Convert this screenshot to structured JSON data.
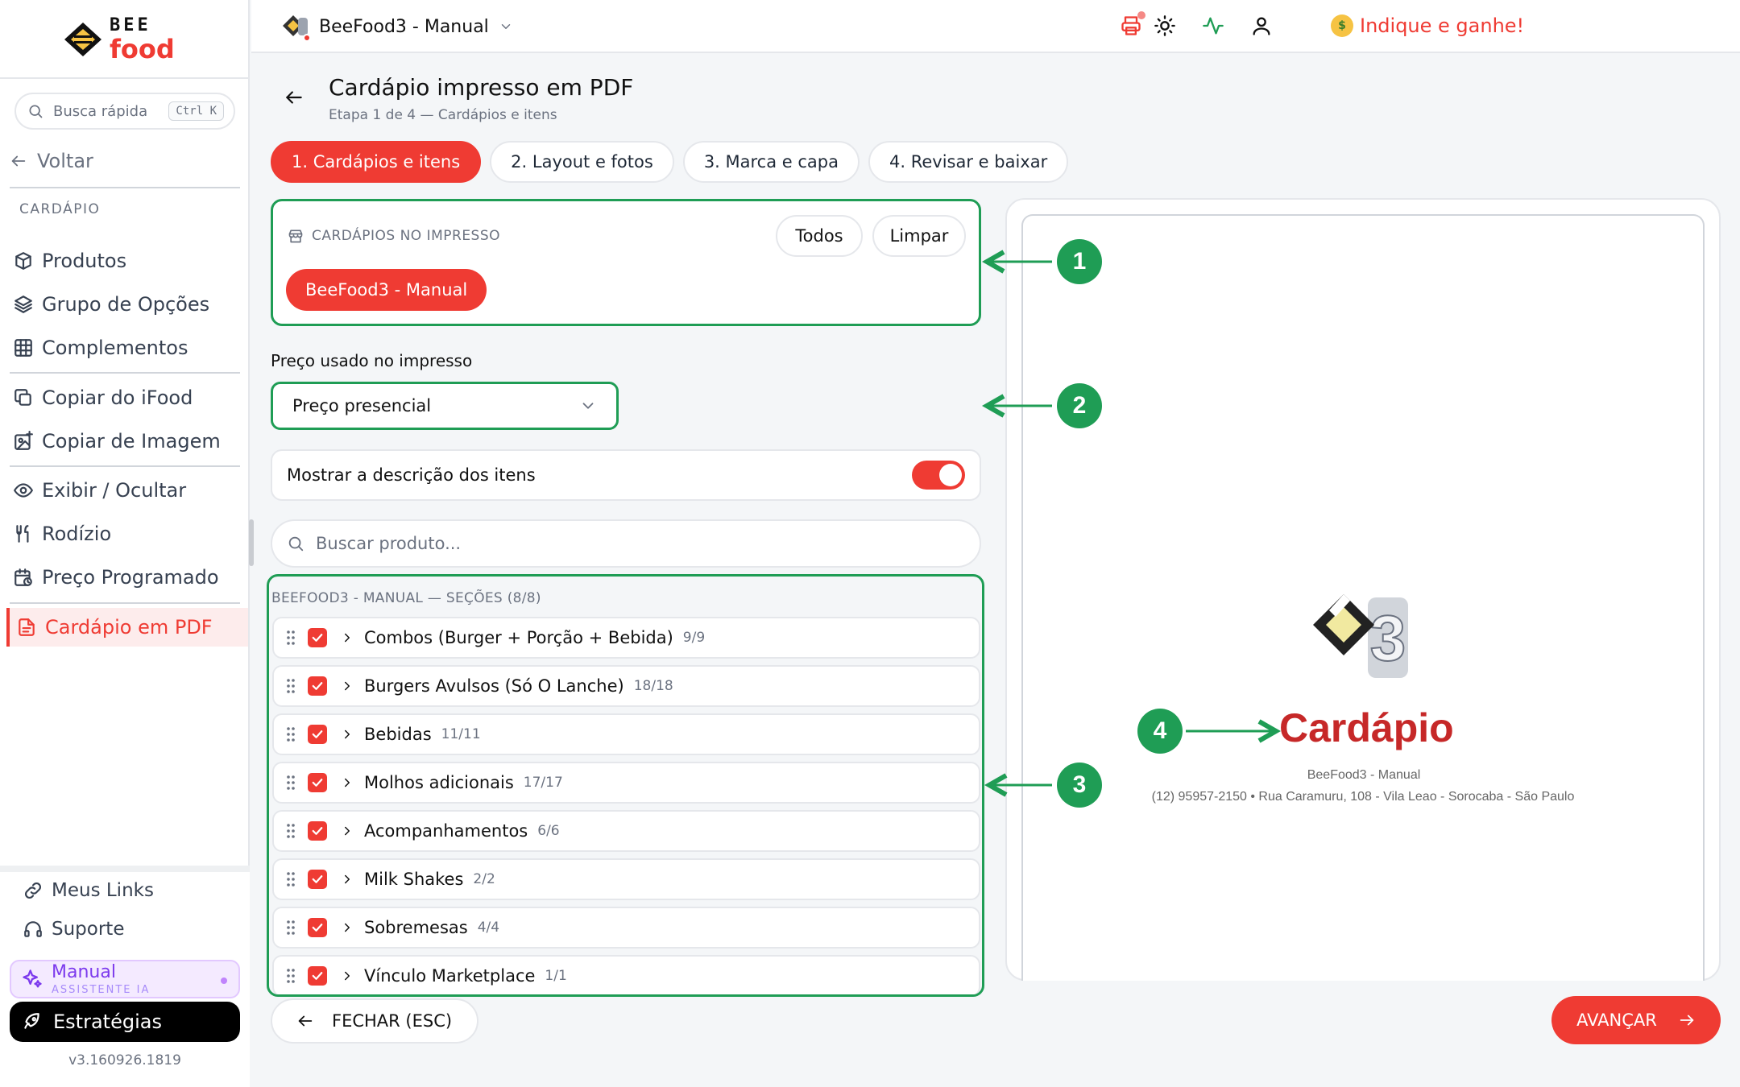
{
  "brand": {
    "line1": "BEE",
    "line2": "food"
  },
  "search": {
    "placeholder": "Busca rápida",
    "shortcut": "Ctrl K"
  },
  "sidebar": {
    "back_label": "Voltar",
    "section_title": "CARDÁPIO",
    "items": [
      {
        "label": "Produtos",
        "icon": "box-icon"
      },
      {
        "label": "Grupo de Opções",
        "icon": "layers-icon"
      },
      {
        "label": "Complementos",
        "icon": "grid-icon"
      },
      {
        "label": "Copiar do iFood",
        "icon": "copy-cloud-icon"
      },
      {
        "label": "Copiar de Imagem",
        "icon": "image-plus-icon"
      },
      {
        "label": "Exibir / Ocultar",
        "icon": "eye-icon"
      },
      {
        "label": "Rodízio",
        "icon": "utensils-icon"
      },
      {
        "label": "Preço Programado",
        "icon": "calendar-clock-icon"
      },
      {
        "label": "Cardápio em PDF",
        "icon": "file-text-icon",
        "active": true
      }
    ],
    "bottom": [
      {
        "label": "Meus Links",
        "icon": "link-icon"
      },
      {
        "label": "Suporte",
        "icon": "headset-icon"
      }
    ],
    "ai": {
      "label": "Manual",
      "sub": "ASSISTENTE IA"
    },
    "strategies_label": "Estratégias",
    "version": "v3.160926.1819"
  },
  "topbar": {
    "store_name": "BeeFood3 - Manual",
    "referral_label": "Indique e ganhe!",
    "icons": [
      "printer-icon",
      "sun-icon",
      "activity-icon",
      "user-icon"
    ]
  },
  "page": {
    "title": "Cardápio impresso em PDF",
    "subtitle": "Etapa 1 de 4 — Cardápios e itens"
  },
  "tabs": [
    {
      "label": "1. Cardápios e itens",
      "active": true
    },
    {
      "label": "2. Layout e fotos"
    },
    {
      "label": "3. Marca e capa"
    },
    {
      "label": "4. Revisar e baixar"
    }
  ],
  "menus_card": {
    "title": "CARDÁPIOS NO IMPRESSO",
    "all_label": "Todos",
    "clear_label": "Limpar",
    "selected_chip": "BeeFood3 - Manual"
  },
  "price": {
    "label": "Preço usado no impresso",
    "value": "Preço presencial"
  },
  "show_description": {
    "label": "Mostrar a descrição dos itens",
    "enabled": true
  },
  "product_search": {
    "placeholder": "Buscar produto..."
  },
  "sections": {
    "header": "BEEFOOD3 - MANUAL — SEÇÕES (8/8)",
    "items": [
      {
        "name": "Combos (Burger + Porção + Bebida)",
        "count": "9/9",
        "checked": true
      },
      {
        "name": "Burgers Avulsos (Só O Lanche)",
        "count": "18/18",
        "checked": true
      },
      {
        "name": "Bebidas",
        "count": "11/11",
        "checked": true
      },
      {
        "name": "Molhos adicionais",
        "count": "17/17",
        "checked": true
      },
      {
        "name": "Acompanhamentos",
        "count": "6/6",
        "checked": true
      },
      {
        "name": "Milk Shakes",
        "count": "2/2",
        "checked": true
      },
      {
        "name": "Sobremesas",
        "count": "4/4",
        "checked": true
      },
      {
        "name": "Vínculo Marketplace",
        "count": "1/1",
        "checked": true
      }
    ]
  },
  "footer": {
    "close_label": "FECHAR (ESC)",
    "next_label": "AVANÇAR"
  },
  "preview": {
    "title": "Cardápio",
    "store": "BeeFood3 - Manual",
    "contact": "(12) 95957-2150  •  Rua Caramuru, 108 - Vila Leao - Sorocaba - São Paulo"
  },
  "annotations": [
    "1",
    "2",
    "3",
    "4"
  ],
  "colors": {
    "accent": "#ef3b33",
    "annotation": "#1f9d55",
    "ai": "#7c3aed"
  }
}
